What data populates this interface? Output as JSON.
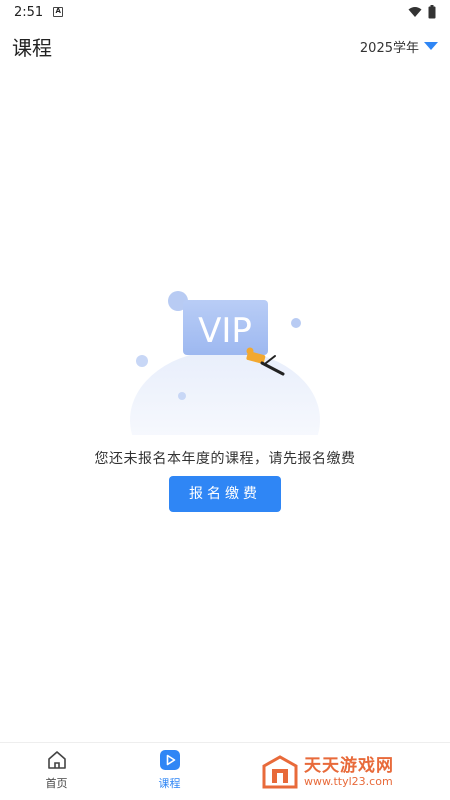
{
  "status": {
    "time": "2:51",
    "notif": "A"
  },
  "header": {
    "title": "课程",
    "year": "2025学年"
  },
  "empty": {
    "message": "您还未报名本年度的课程，请先报名缴费",
    "button": "报名缴费",
    "badge": "VIP"
  },
  "tabs": [
    {
      "label": "首页",
      "icon": "home-icon",
      "active": false
    },
    {
      "label": "课程",
      "icon": "play-icon",
      "active": true
    }
  ],
  "watermark": {
    "title": "天天游戏网",
    "url": "www.ttyl23.com"
  },
  "colors": {
    "accent": "#2f86f5",
    "watermark": "#e86a3a"
  }
}
